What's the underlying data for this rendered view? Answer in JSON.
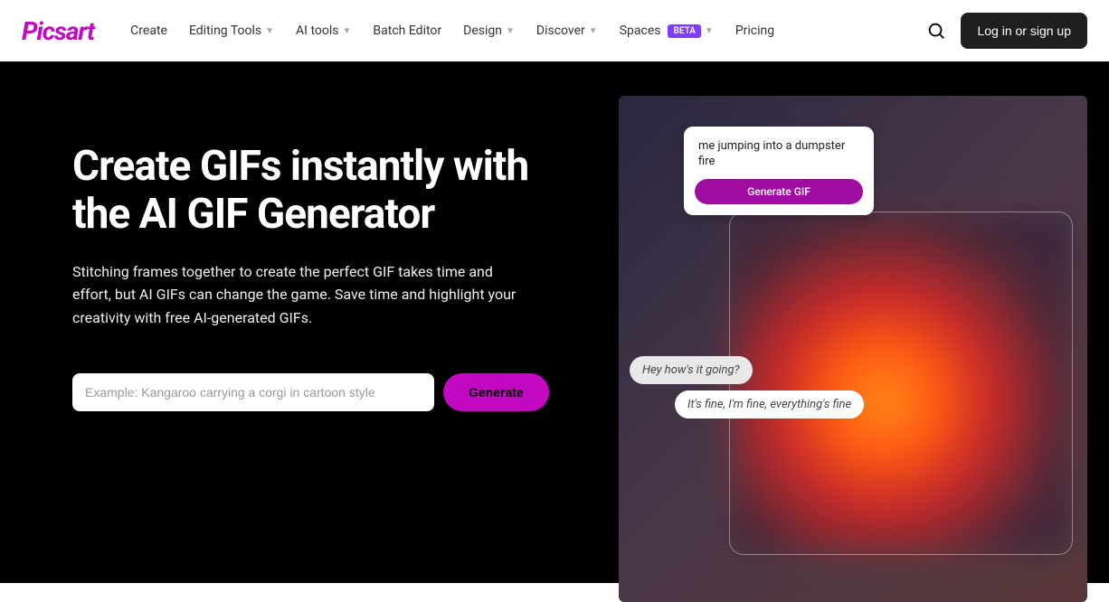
{
  "brand": "Picsart",
  "nav": {
    "items": [
      {
        "label": "Create",
        "dropdown": false,
        "badge": null
      },
      {
        "label": "Editing Tools",
        "dropdown": true,
        "badge": null
      },
      {
        "label": "AI tools",
        "dropdown": true,
        "badge": null
      },
      {
        "label": "Batch Editor",
        "dropdown": false,
        "badge": null
      },
      {
        "label": "Design",
        "dropdown": true,
        "badge": null
      },
      {
        "label": "Discover",
        "dropdown": true,
        "badge": null
      },
      {
        "label": "Spaces",
        "dropdown": true,
        "badge": "BETA"
      },
      {
        "label": "Pricing",
        "dropdown": false,
        "badge": null
      }
    ]
  },
  "header": {
    "login_label": "Log in or sign up"
  },
  "hero": {
    "title": "Create GIFs instantly with the AI GIF Generator",
    "description": "Stitching frames together to create the perfect GIF takes time and effort, but AI GIFs can change the game. Save time and highlight your creativity with free AI-generated GIFs.",
    "input_placeholder": "Example: Kangaroo carrying a corgi in cartoon style",
    "generate_label": "Generate"
  },
  "illustration": {
    "prompt_text": "me jumping into a dumpster fire",
    "prompt_button": "Generate GIF",
    "chat1": "Hey how's it going?",
    "chat2": "It's fine, I'm fine, everything's fine"
  },
  "colors": {
    "brand_pink": "#c209c1",
    "badge_purple": "#7d3cff"
  }
}
